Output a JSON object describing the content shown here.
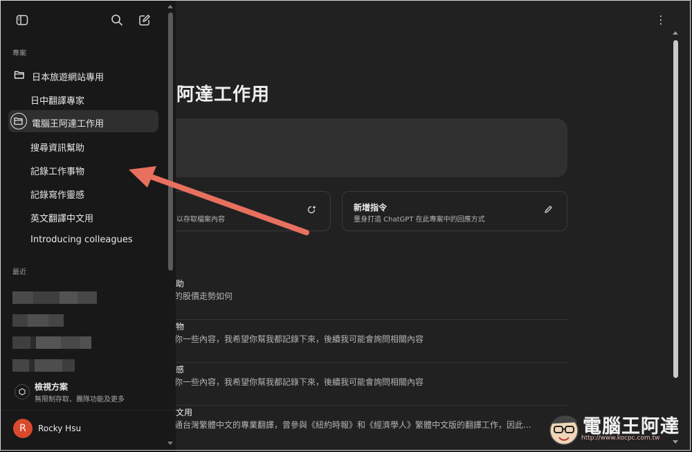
{
  "sidebar": {
    "projects_label": "專案",
    "recent_label": "最近",
    "projects": [
      {
        "label": "日本旅遊網站專用"
      },
      {
        "label": "日中翻譯專家"
      },
      {
        "label": "電腦王阿達工作用"
      },
      {
        "label": "搜尋資訊幫助"
      },
      {
        "label": "記錄工作事物"
      },
      {
        "label": "記錄寫作靈感"
      },
      {
        "label": "英文翻譯中文用"
      },
      {
        "label": "Introducing colleagues"
      }
    ],
    "upgrade": {
      "title": "檢視方案",
      "subtitle": "無限制存取、團隊功能及更多"
    },
    "user": {
      "initial": "R",
      "name": "Rocky Hsu"
    }
  },
  "main": {
    "title": "阿達工作用",
    "cards": {
      "files": {
        "subtitle": "以存取檔案內容"
      },
      "instructions": {
        "title": "新增指令",
        "subtitle": "量身打造 ChatGPT 在此專案中的回應方式"
      }
    },
    "chats": [
      {
        "title": "助",
        "preview": "前的股價走勢如何"
      },
      {
        "title": "物",
        "preview": "給你一些內容，我希望你幫我都記錄下來，後續我可能會詢問相關內容"
      },
      {
        "title": "感",
        "preview": "給你一些內容，我希望你幫我都記錄下來，後續我可能會詢問相關內容"
      },
      {
        "title": "文用",
        "preview": "適通台灣繁體中文的專業翻譯，曾參與《紐約時報》和《經濟學人》繁體中文版的翻譯工作，因此..."
      }
    ]
  },
  "watermark": {
    "text": "電腦王阿達",
    "url": "http://www.kocpc.com.tw"
  },
  "colors": {
    "accent_arrow": "#e8705f",
    "avatar": "#d9492c",
    "sidebar_bg": "#181818",
    "main_bg": "#212121"
  }
}
